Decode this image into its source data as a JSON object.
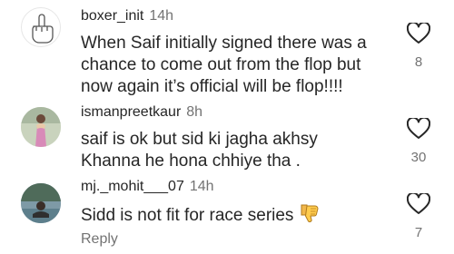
{
  "comments": [
    {
      "username": "boxer_init",
      "time": "14h",
      "lines": [
        "When Saif initially signed there was a",
        "chance to come out from the flop but",
        "now again it’s official will be flop!!!!"
      ],
      "like_count": "8",
      "avatar_icon": "middle-finger-icon"
    },
    {
      "username": "ismanpreetkaur",
      "time": "8h",
      "lines": [
        "saif is ok but sid ki jagha akhsy",
        "Khanna he hona chhiye tha ."
      ],
      "like_count": "30",
      "avatar_icon": "profile-photo"
    },
    {
      "username": "mj._mohit___07",
      "time": "14h",
      "lines": [
        "Sidd is not fit for race series"
      ],
      "emoji": "thumbs-down-icon",
      "like_count": "7",
      "avatar_icon": "profile-photo"
    }
  ],
  "reply_label": "Reply",
  "colors": {
    "text": "#262626",
    "secondary": "#737373"
  }
}
